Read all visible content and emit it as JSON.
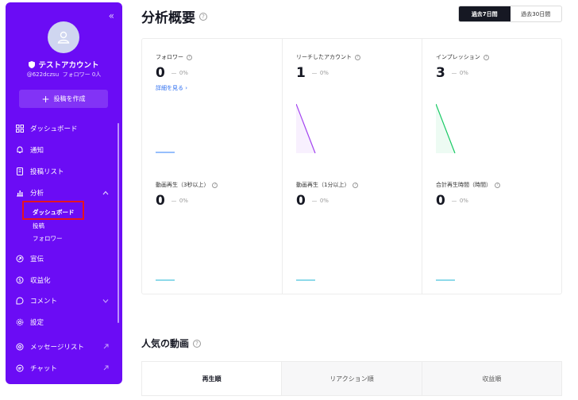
{
  "sidebar": {
    "collapse_glyph": "«",
    "account": {
      "name": "テストアカウント",
      "handle": "@622dczsu",
      "followers": "フォロワー 0人"
    },
    "create_button": "投稿を作成",
    "items": [
      {
        "label": "ダッシュボード",
        "icon": "dashboard-grid-icon"
      },
      {
        "label": "通知",
        "icon": "bell-icon"
      },
      {
        "label": "投稿リスト",
        "icon": "list-icon"
      },
      {
        "label": "分析",
        "icon": "chart-icon",
        "expanded": true
      },
      {
        "label": "宣伝",
        "icon": "promote-icon"
      },
      {
        "label": "収益化",
        "icon": "dollar-icon"
      },
      {
        "label": "コメント",
        "icon": "comment-icon"
      },
      {
        "label": "設定",
        "icon": "gear-icon"
      },
      {
        "label": "メッセージリスト",
        "icon": "message-icon"
      },
      {
        "label": "チャット",
        "icon": "chat-icon"
      }
    ],
    "sub_items": [
      "ダッシュボード",
      "投稿",
      "フォロワー"
    ]
  },
  "main": {
    "title": "分析概要",
    "range_options": [
      "過去7日間",
      "過去30日間"
    ],
    "metrics": [
      {
        "label": "フォロワー",
        "value": "0",
        "change": "0%",
        "detail": "詳細を見る ›",
        "color": "#2d7ff9"
      },
      {
        "label": "リーチしたアカウント",
        "value": "1",
        "change": "0%",
        "color": "#a243f0"
      },
      {
        "label": "インプレッション",
        "value": "3",
        "change": "0%",
        "color": "#18c964"
      },
      {
        "label": "動画再生（3秒以上）",
        "value": "0",
        "change": "0%",
        "color": "#1fb5d6"
      },
      {
        "label": "動画再生（1分以上）",
        "value": "0",
        "change": "0%",
        "color": "#1fb5d6"
      },
      {
        "label": "合計再生時間（時間）",
        "value": "0",
        "change": "0%",
        "color": "#1fb5d6"
      }
    ],
    "popular_title": "人気の動画",
    "tabs": [
      "再生順",
      "リアクション順",
      "収益順"
    ]
  }
}
